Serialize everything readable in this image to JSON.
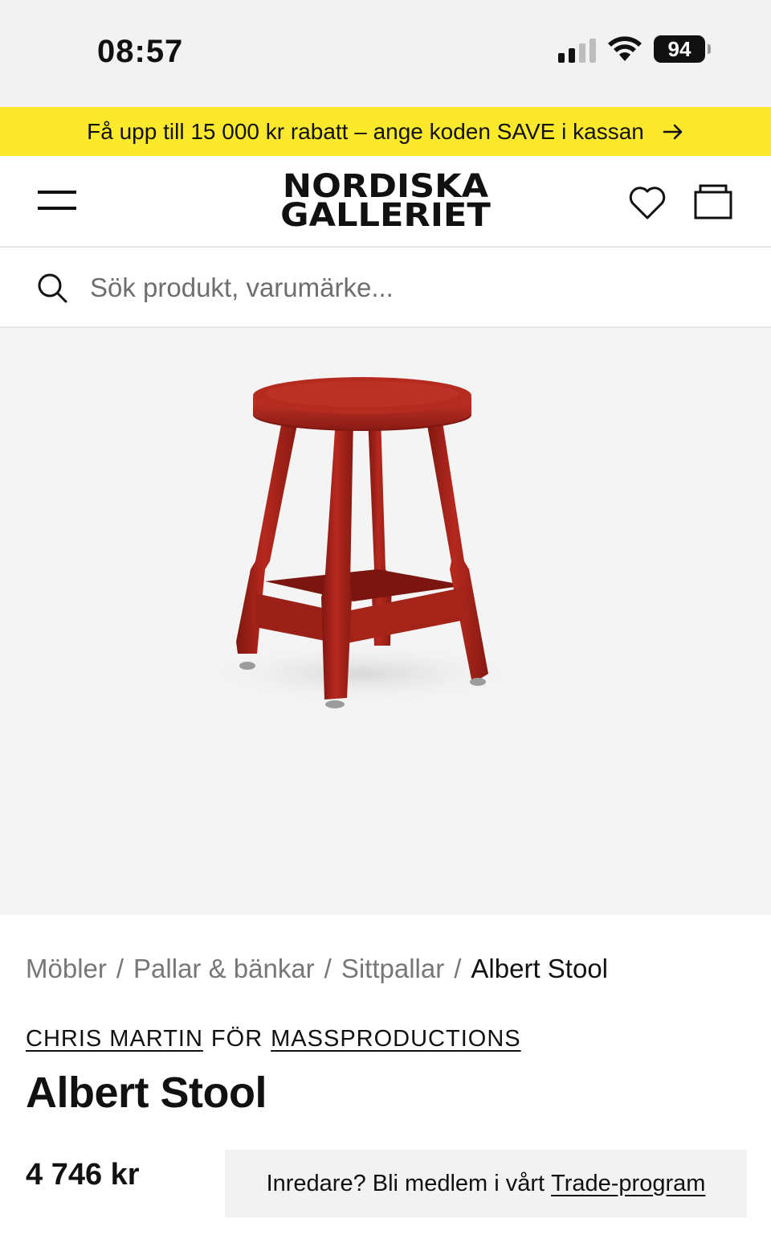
{
  "status_bar": {
    "time": "08:57",
    "battery": "94"
  },
  "promo": {
    "text": "Få upp till 15 000 kr rabatt – ange koden SAVE i kassan",
    "arrow_icon": "arrow-right-icon",
    "background": "#fde92b"
  },
  "header": {
    "logo_line1": "NORDISKA",
    "logo_line2": "GALLERIET",
    "icons": [
      "menu-icon",
      "heart-icon",
      "cart-icon"
    ]
  },
  "search": {
    "placeholder": "Sök produkt, varumärke..."
  },
  "breadcrumb": {
    "items": [
      "Möbler",
      "Pallar & bänkar",
      "Sittpallar"
    ],
    "current": "Albert Stool",
    "separator": "/"
  },
  "product": {
    "designer": "CHRIS MARTIN",
    "connector": "FÖR",
    "brand": "MASSPRODUCTIONS",
    "title": "Albert Stool",
    "price": "4 746 kr",
    "color": "#a8231b"
  },
  "trade": {
    "text": "Inredare? Bli medlem i vårt",
    "link": "Trade-program"
  }
}
